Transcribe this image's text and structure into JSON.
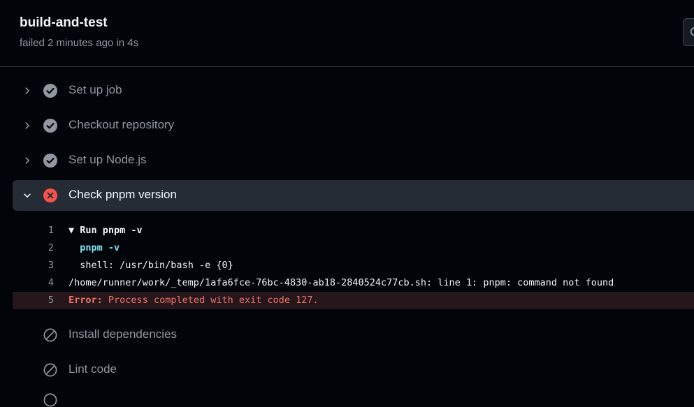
{
  "job": {
    "title": "build-and-test",
    "meta": "failed 2 minutes ago in 4s"
  },
  "steps": [
    {
      "label": "Set up job",
      "status": "success"
    },
    {
      "label": "Checkout repository",
      "status": "success"
    },
    {
      "label": "Set up Node.js",
      "status": "success"
    },
    {
      "label": "Check pnpm version",
      "status": "failure"
    },
    {
      "label": "Install dependencies",
      "status": "skipped"
    },
    {
      "label": "Lint code",
      "status": "skipped"
    }
  ],
  "log": {
    "lines": [
      {
        "num": "1",
        "marker": "▼",
        "text": "Run pnpm -v"
      },
      {
        "num": "2",
        "text": "pnpm -v"
      },
      {
        "num": "3",
        "text": "shell: /usr/bin/bash -e {0}"
      },
      {
        "num": "4",
        "text": "/home/runner/work/_temp/1afa6fce-76bc-4830-ab18-2840524c77cb.sh: line 1: pnpm: command not found"
      },
      {
        "num": "5",
        "error_label": "Error:",
        "text": "Process completed with exit code 127."
      }
    ]
  },
  "colors": {
    "success": "#9198a1",
    "failure": "#f85149",
    "command": "#7ee2f5",
    "error_text": "#f47067"
  }
}
